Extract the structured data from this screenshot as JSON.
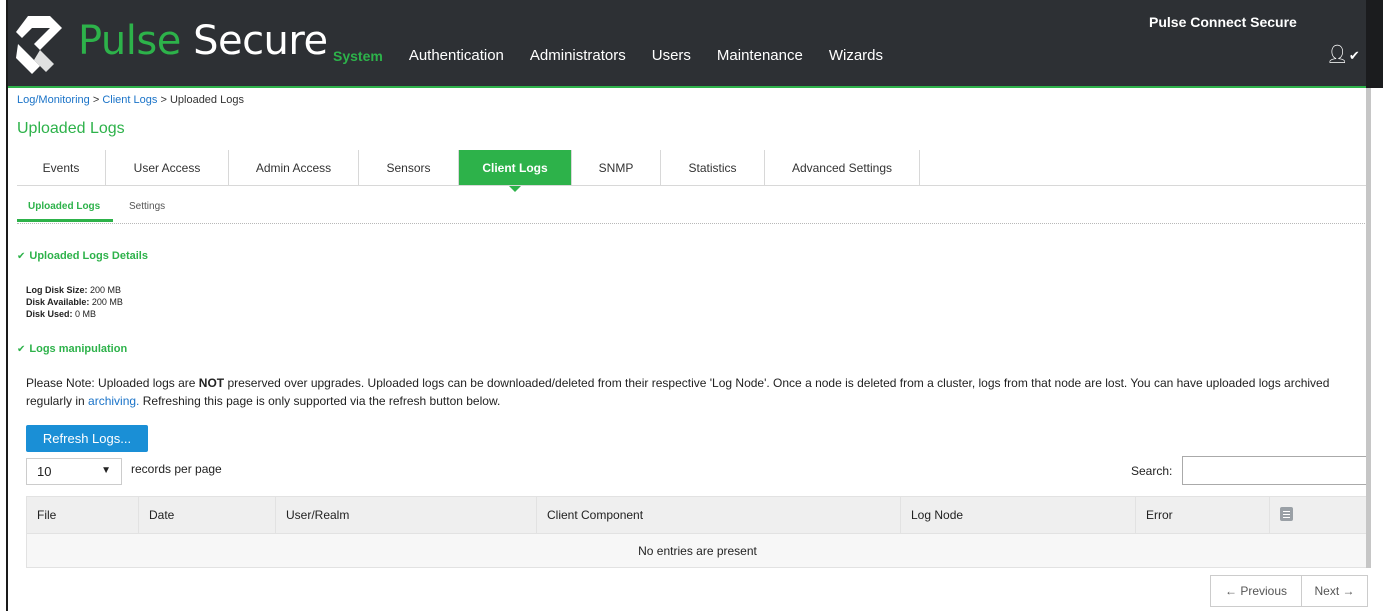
{
  "header": {
    "brand_part1": "Pulse",
    "brand_part2": "Secure",
    "product": "Pulse Connect Secure",
    "nav": [
      {
        "label": "System",
        "active": true
      },
      {
        "label": "Authentication"
      },
      {
        "label": "Administrators"
      },
      {
        "label": "Users"
      },
      {
        "label": "Maintenance"
      },
      {
        "label": "Wizards"
      }
    ],
    "user_icon": "user-icon"
  },
  "breadcrumb": {
    "items": [
      "Log/Monitoring",
      "Client Logs"
    ],
    "sep": ">",
    "current": "Uploaded Logs"
  },
  "page": {
    "title": "Uploaded Logs"
  },
  "tabs": [
    {
      "label": "Events"
    },
    {
      "label": "User Access"
    },
    {
      "label": "Admin Access"
    },
    {
      "label": "Sensors"
    },
    {
      "label": "Client Logs",
      "active": true
    },
    {
      "label": "SNMP"
    },
    {
      "label": "Statistics"
    },
    {
      "label": "Advanced Settings"
    }
  ],
  "subtabs": [
    {
      "label": "Uploaded Logs",
      "active": true
    },
    {
      "label": "Settings"
    }
  ],
  "details": {
    "heading": "Uploaded Logs Details",
    "log_disk_size_label": "Log Disk Size:",
    "log_disk_size": "200 MB",
    "disk_available_label": "Disk Available:",
    "disk_available": "200 MB",
    "disk_used_label": "Disk Used:",
    "disk_used": "0 MB"
  },
  "manipulation": {
    "heading": "Logs manipulation",
    "note_part1": "Please Note: Uploaded logs are ",
    "note_strong": "NOT",
    "note_part2": " preserved over upgrades. Uploaded logs can be downloaded/deleted from their respective 'Log Node'. Once a node is deleted from a cluster, logs from that node are lost. You can have uploaded logs archived regularly in ",
    "note_link": "archiving.",
    "note_part3": " Refreshing this page is only supported via the refresh button below.",
    "refresh_button": "Refresh Logs..."
  },
  "table_controls": {
    "records_value": "10",
    "records_label": "records per page",
    "search_label": "Search:",
    "search_value": ""
  },
  "table": {
    "columns": [
      "File",
      "Date",
      "User/Realm",
      "Client Component",
      "Log Node",
      "Error"
    ],
    "delete_icon": "trash-icon",
    "empty_message": "No entries are present"
  },
  "pagination": {
    "previous": "← Previous",
    "next": "Next →"
  },
  "colors": {
    "accent_green": "#2db24a",
    "header_bg": "#2d3034",
    "link_blue": "#1a73c8",
    "button_blue": "#1a8fd6"
  }
}
